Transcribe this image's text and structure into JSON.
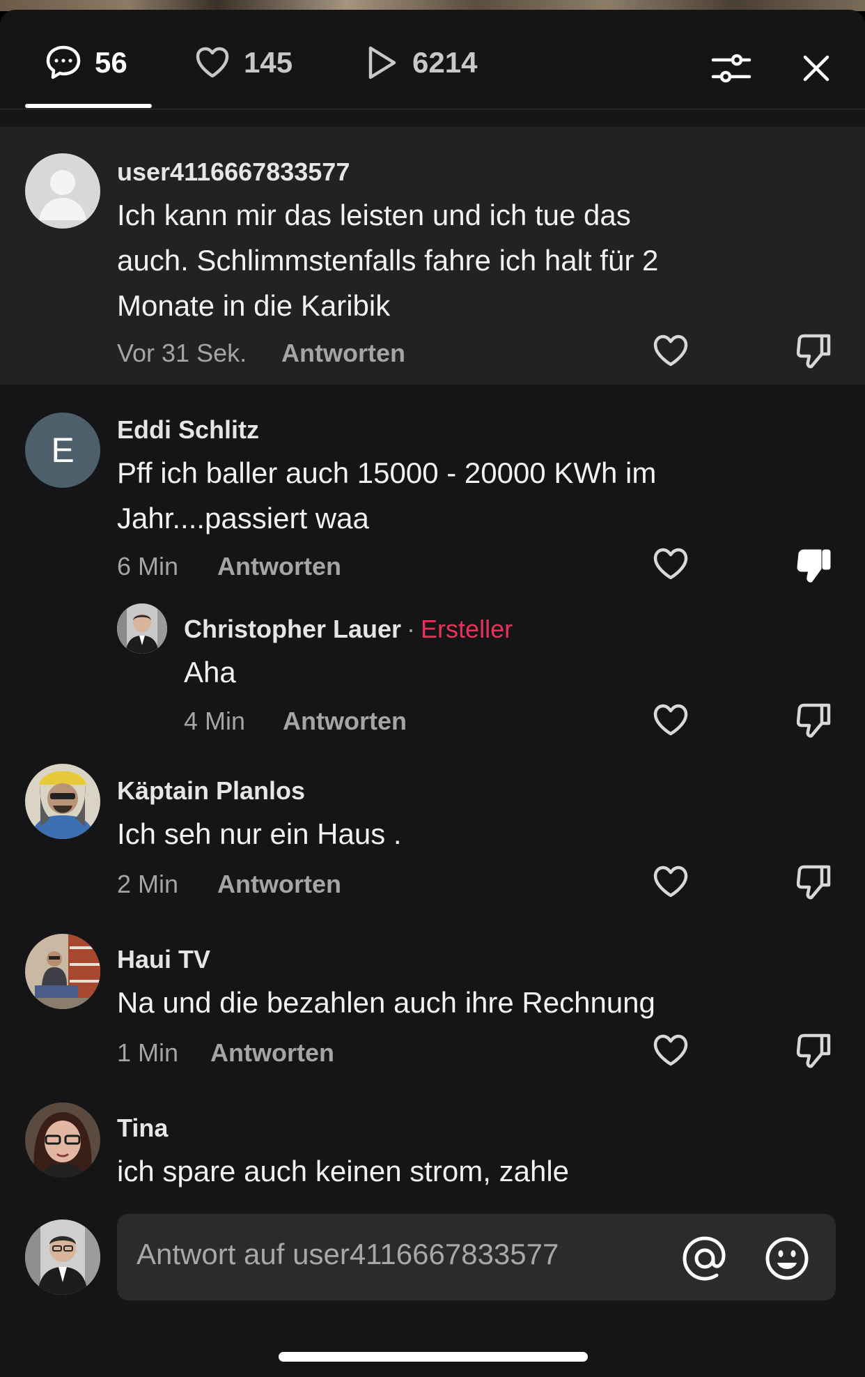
{
  "header": {
    "comments_count": "56",
    "likes_count": "145",
    "plays_count": "6214",
    "icons": [
      "comment-icon",
      "heart-icon",
      "play-icon",
      "filter-sliders-icon",
      "close-icon"
    ]
  },
  "comments": [
    {
      "username": "user4116667833577",
      "lines": [
        "Ich kann mir das leisten und ich tue das",
        "auch. Schlimmstenfalls fahre ich halt für 2",
        "Monate in die Karibik"
      ],
      "time": "Vor 31 Sek.",
      "reply_label": "Antworten"
    },
    {
      "username": "Eddi Schlitz",
      "avatar_letter": "E",
      "lines": [
        "Pff ich baller auch 15000 - 20000 KWh im",
        "Jahr....passiert waa"
      ],
      "time": "6 Min",
      "reply_label": "Antworten",
      "disliked": true
    },
    {
      "username": "Christopher Lauer",
      "creator_badge": "Ersteller",
      "separator": "·",
      "lines": [
        "Aha"
      ],
      "time": "4 Min",
      "reply_label": "Antworten"
    },
    {
      "username": "Käptain Planlos",
      "lines": [
        "Ich seh nur ein Haus ."
      ],
      "time": "2 Min",
      "reply_label": "Antworten"
    },
    {
      "username": "Haui TV",
      "lines": [
        "Na und die bezahlen auch ihre Rechnung"
      ],
      "time": "1 Min",
      "reply_label": "Antworten"
    },
    {
      "username": "Tina",
      "lines": [
        "ich spare auch keinen strom, zahle"
      ]
    }
  ],
  "reply_input": {
    "placeholder": "Antwort auf user4116667833577"
  },
  "colors": {
    "background": "#151517",
    "highlight": "#222225",
    "creator": "#e53359",
    "muted": "#a5a5a8"
  }
}
